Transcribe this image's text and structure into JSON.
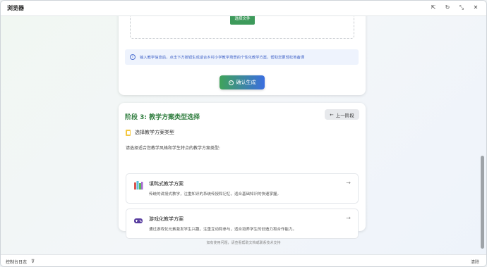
{
  "window": {
    "title": "浏览器",
    "controls": [
      "pin-icon",
      "refresh-icon",
      "collapse-icon",
      "close-icon"
    ]
  },
  "upload": {
    "file_button": "选择文件"
  },
  "info": {
    "icon": "info-icon",
    "text": "输入教学信息后，点击下方按钮生成适合乡村小学教学场景的个性化教学方案，帮助您更轻松地备课"
  },
  "generate": {
    "icon": "check-circle-icon",
    "label": "确认生成"
  },
  "stage3": {
    "title": "阶段 3: 教学方案类型选择",
    "prev_label": "上一阶段",
    "subtitle": "选择教学方案类型",
    "prompt": "请选择适合您教学风格和学生特点的教学方案类型:",
    "options": [
      {
        "icon": "books-icon",
        "title": "填鸭式教学方案",
        "desc": "传统的讲授式教学，注重知识的系统传授和记忆，适合基础知识的快速掌握。"
      },
      {
        "icon": "gamepad-icon",
        "title": "游戏化教学方案",
        "desc": "通过游戏化元素激发学生兴趣，注重互动和参与，适合培养学生的创造力和合作能力。"
      }
    ]
  },
  "footer": {
    "note": "如有使用问题，请查看帮助文档或联系技术支持"
  },
  "console": {
    "log_label": "控制台日志",
    "clear_label": "清除"
  },
  "colors": {
    "accent_green": "#3d9a5b",
    "accent_blue": "#3b6ee0",
    "stage_title": "#2f7d3e"
  }
}
